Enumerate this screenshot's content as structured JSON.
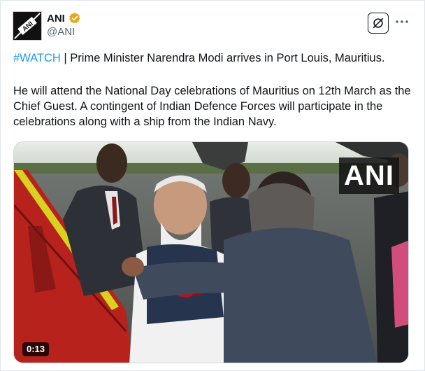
{
  "account": {
    "display_name": "ANI",
    "handle": "@ANI",
    "avatar_text": "ANI",
    "verified_color": "#e8a81c"
  },
  "actions": {
    "grok_icon": "grok-icon",
    "more_icon": "more-icon"
  },
  "tweet": {
    "hashtag": "#WATCH",
    "line1_rest": " | Prime Minister Narendra Modi arrives in Port Louis, Mauritius.",
    "paragraph2": "He will attend the National Day celebrations of Mauritius on 12th March as the Chief Guest. A contingent of Indian Defence Forces will participate in the celebrations along with a ship from the Indian Navy."
  },
  "media": {
    "watermark": "ANI",
    "duration": "0:13"
  },
  "colors": {
    "link": "#1d9bf0",
    "text": "#0f1419",
    "secondary": "#536471"
  }
}
